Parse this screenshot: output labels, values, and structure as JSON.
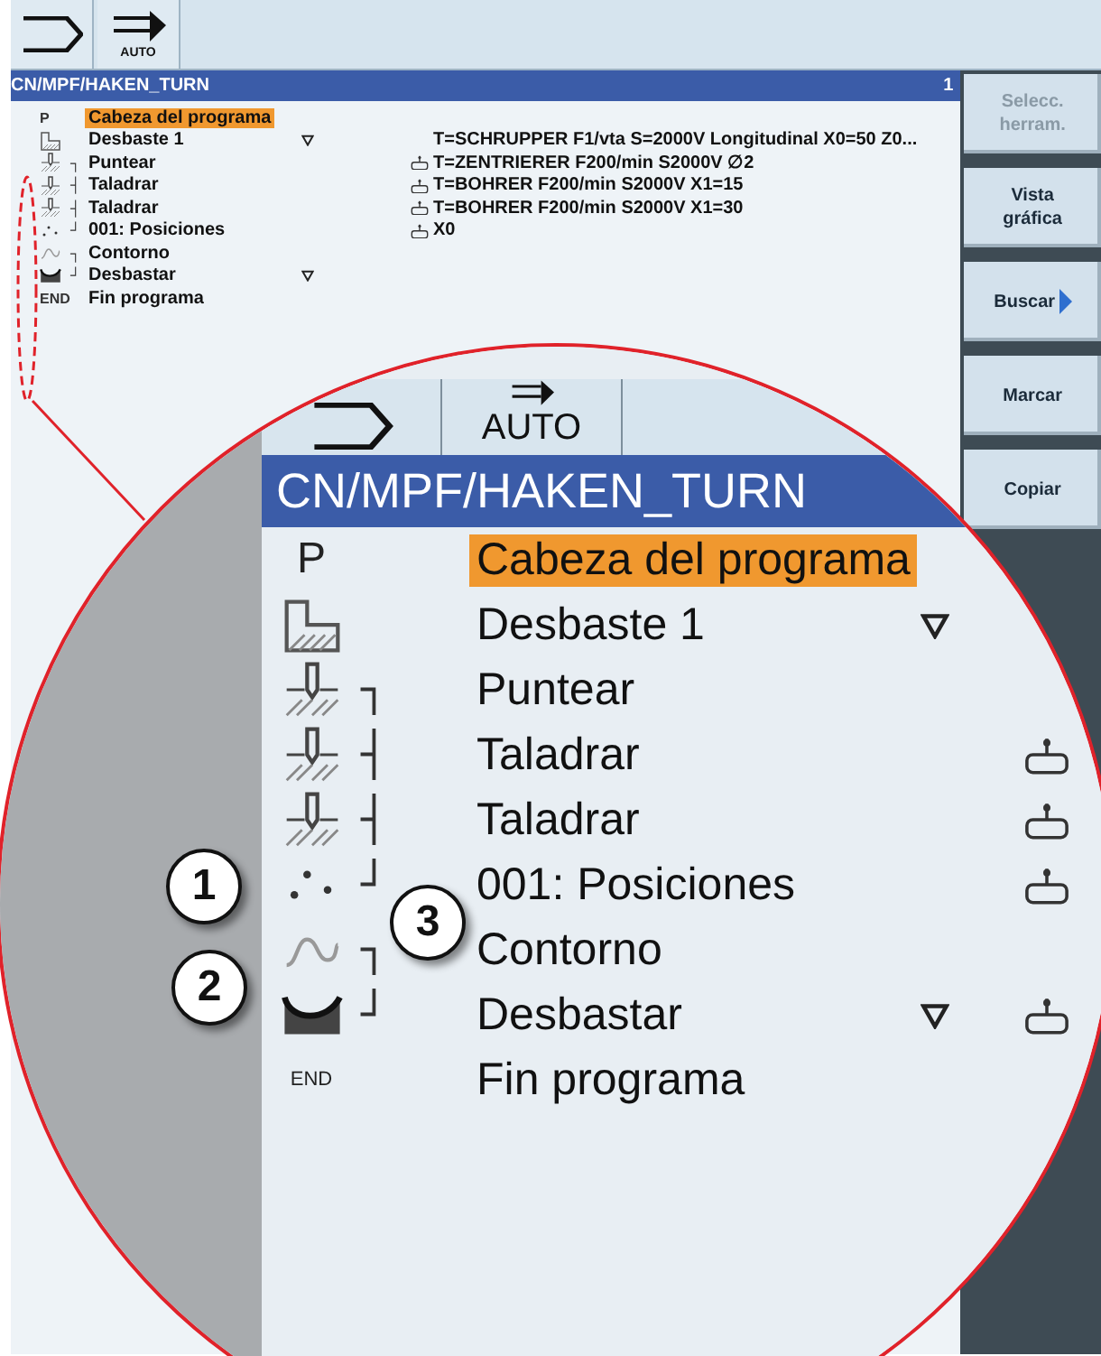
{
  "toolbar": {
    "buttons": [
      {
        "kind": "jog"
      },
      {
        "kind": "auto",
        "label": "AUTO"
      }
    ]
  },
  "program": {
    "path": "CN/MPF/HAKEN_TURN",
    "channel": "1",
    "rows": [
      {
        "marker": "P",
        "name": "Cabeza del programa",
        "selected": true
      },
      {
        "kind": "roughing",
        "name": "Desbaste 1",
        "selected": false,
        "expand": true,
        "params": "T=SCHRUPPER F1/vta S=2000V Longitudinal X0=50 Z0..."
      },
      {
        "kind": "drill",
        "branch": "┐",
        "name": "Puntear",
        "selected": false,
        "tool": true,
        "params": "T=ZENTRIERER F200/min S2000V ∅2"
      },
      {
        "kind": "drill",
        "branch": "┤",
        "name": "Taladrar",
        "selected": false,
        "tool": true,
        "params": "T=BOHRER F200/min S2000V X1=15"
      },
      {
        "kind": "drill",
        "branch": "┤",
        "name": "Taladrar",
        "selected": false,
        "tool": true,
        "params": "T=BOHRER F200/min S2000V X1=30"
      },
      {
        "kind": "positions",
        "branch": "┘",
        "name": "001: Posiciones",
        "selected": false,
        "tool": true,
        "params": "X0"
      },
      {
        "kind": "contour",
        "branch": "┐",
        "name": "Contorno",
        "selected": false
      },
      {
        "kind": "stock",
        "branch": "┘",
        "name": "Desbastar",
        "selected": false,
        "expand": true
      },
      {
        "marker": "END",
        "name": "Fin programa",
        "selected": false
      }
    ]
  },
  "softkeys": [
    {
      "label": [
        "Selecc.",
        "herram."
      ],
      "disabled": true
    },
    {
      "label": [
        "Vista",
        "gráfica"
      ],
      "disabled": false
    },
    {
      "label": [
        "Buscar"
      ],
      "disabled": false,
      "submenu": true
    },
    {
      "label": [
        "Marcar"
      ],
      "disabled": false
    },
    {
      "label": [
        "Copiar"
      ],
      "disabled": false
    }
  ],
  "magnifier": {
    "tabs": [
      {
        "kind": "jog"
      },
      {
        "kind": "auto",
        "label": "AUTO"
      }
    ],
    "path": "CN/MPF/HAKEN_TURN",
    "rows": [
      {
        "marker": "P",
        "name": "Cabeza del programa",
        "selected": true
      },
      {
        "kind": "roughing",
        "name": "Desbaste 1",
        "selected": false,
        "expand": true
      },
      {
        "kind": "drill",
        "branch": "┐",
        "name": "Puntear",
        "selected": false
      },
      {
        "kind": "drill",
        "branch": "┤",
        "name": "Taladrar",
        "selected": false,
        "tool": true
      },
      {
        "kind": "drill",
        "branch": "┤",
        "name": "Taladrar",
        "selected": false,
        "tool": true
      },
      {
        "kind": "positions",
        "branch": "┘",
        "name": "001: Posiciones",
        "selected": false,
        "tool": true
      },
      {
        "kind": "contour",
        "branch": "┐",
        "name": "Contorno",
        "selected": false
      },
      {
        "kind": "stock",
        "branch": "┘",
        "name": "Desbastar",
        "selected": false,
        "expand": true,
        "tool": true
      },
      {
        "marker": "END",
        "name": "Fin programa",
        "selected": false
      }
    ],
    "callouts": [
      "1",
      "2",
      "3"
    ]
  }
}
